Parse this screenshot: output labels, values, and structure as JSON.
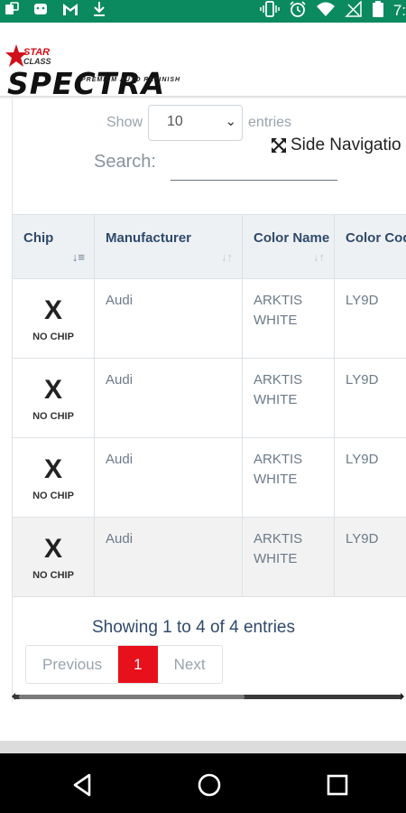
{
  "status_bar": {
    "left_icons": [
      "app-icon",
      "robot-icon",
      "gmail-icon",
      "download-icon"
    ],
    "right_icons": [
      "vibrate-icon",
      "alarm-icon",
      "wifi-icon",
      "signal-off-icon",
      "battery-icon"
    ],
    "clock": "7:"
  },
  "logo": {
    "brand_top": "STAR",
    "brand_sub": "CLASS",
    "name": "SPECTRA",
    "tagline": "PREMIUM AUTO REFINISH"
  },
  "controls": {
    "show_label": "Show",
    "page_length": "10",
    "entries_label": "entries",
    "side_nav_label": "Side Navigatio",
    "search_label": "Search:",
    "search_value": ""
  },
  "table": {
    "headers": [
      "Chip",
      "Manufacturer",
      "Color Name",
      "Color Code"
    ],
    "rows": [
      {
        "chip": "X",
        "chip_sub": "NO CHIP",
        "manufacturer": "Audi",
        "color_name": "ARKTIS WHITE",
        "color_code": "LY9D"
      },
      {
        "chip": "X",
        "chip_sub": "NO CHIP",
        "manufacturer": "Audi",
        "color_name": "ARKTIS WHITE",
        "color_code": "LY9D"
      },
      {
        "chip": "X",
        "chip_sub": "NO CHIP",
        "manufacturer": "Audi",
        "color_name": "ARKTIS WHITE",
        "color_code": "LY9D"
      },
      {
        "chip": "X",
        "chip_sub": "NO CHIP",
        "manufacturer": "Audi",
        "color_name": "ARKTIS WHITE",
        "color_code": "LY9D"
      }
    ]
  },
  "info": "Showing 1 to 4 of 4 entries",
  "pagination": {
    "previous": "Previous",
    "current": "1",
    "next": "Next"
  },
  "colors": {
    "status_bar": "#0b8a5f",
    "accent": "#e8101b",
    "header_text": "#2f4a6b"
  }
}
